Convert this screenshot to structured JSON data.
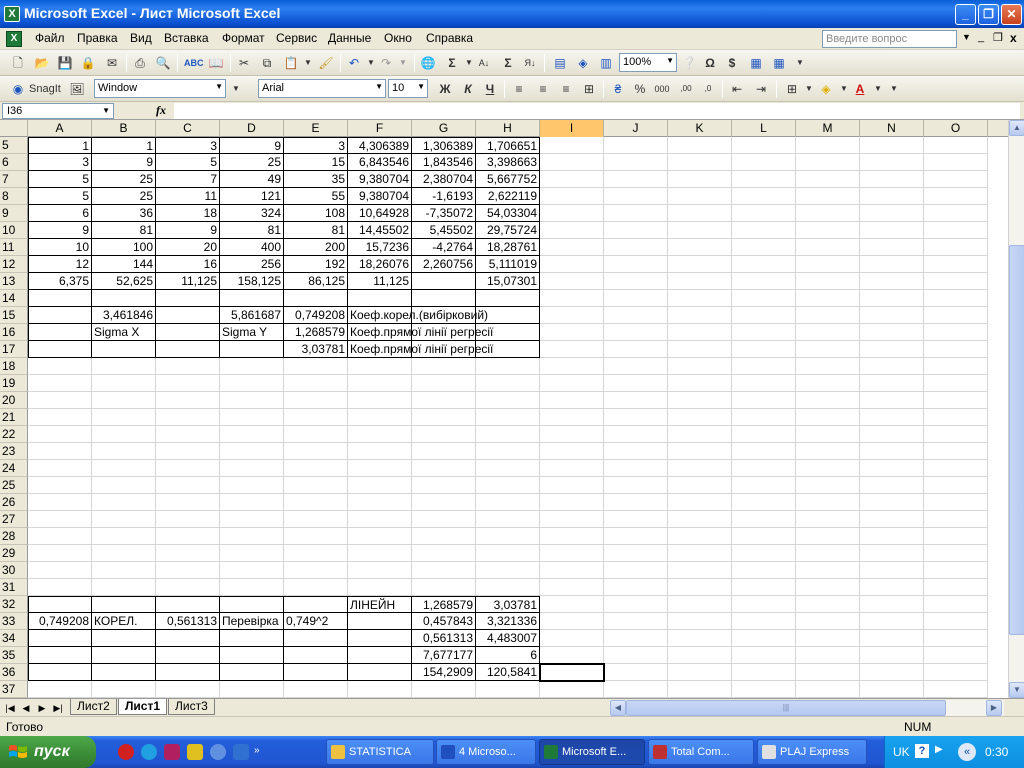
{
  "window": {
    "title": "Microsoft Excel - Лист Microsoft Excel",
    "app_icon": "excel-icon"
  },
  "menu": [
    "Файл",
    "Правка",
    "Вид",
    "Вставка",
    "Формат",
    "Сервис",
    "Данные",
    "Окно",
    "Справка"
  ],
  "ask_placeholder": "Введите вопрос",
  "toolbar1": {
    "zoom": "100%",
    "icons": [
      "new-icon",
      "open-icon",
      "save-icon",
      "permission-icon",
      "email-icon",
      "print-icon",
      "print-preview-icon",
      "spelling-icon",
      "research-icon",
      "cut-icon",
      "copy-icon",
      "paste-icon",
      "format-painter-icon",
      "undo-icon",
      "redo-icon",
      "hyperlink-icon",
      "autosum-icon",
      "sort-ascending-icon",
      "chart-wizard-icon",
      "drawing-icon",
      "help-icon"
    ]
  },
  "toolbar2": {
    "snagit_label": "SnagIt",
    "window_combo": "Window",
    "font": "Arial",
    "size": "10",
    "bold": "Ж",
    "italic": "К",
    "underline": "Ч",
    "percent": "%",
    "thousands": "000"
  },
  "formula_bar": {
    "name_box": "I36",
    "fx": "fx",
    "value": ""
  },
  "columns": [
    "A",
    "B",
    "C",
    "D",
    "E",
    "F",
    "G",
    "H",
    "I",
    "J",
    "K",
    "L",
    "M",
    "N",
    "O"
  ],
  "selected_column": "I",
  "rows": [
    {
      "n": "5",
      "cells": [
        "1",
        "1",
        "3",
        "9",
        "3",
        "4,306389",
        "1,306389",
        "1,706651",
        "",
        "",
        "",
        "",
        "",
        "",
        ""
      ]
    },
    {
      "n": "6",
      "cells": [
        "3",
        "9",
        "5",
        "25",
        "15",
        "6,843546",
        "1,843546",
        "3,398663",
        "",
        "",
        "",
        "",
        "",
        "",
        ""
      ]
    },
    {
      "n": "7",
      "cells": [
        "5",
        "25",
        "7",
        "49",
        "35",
        "9,380704",
        "2,380704",
        "5,667752",
        "",
        "",
        "",
        "",
        "",
        "",
        ""
      ]
    },
    {
      "n": "8",
      "cells": [
        "5",
        "25",
        "11",
        "121",
        "55",
        "9,380704",
        "-1,6193",
        "2,622119",
        "",
        "",
        "",
        "",
        "",
        "",
        ""
      ]
    },
    {
      "n": "9",
      "cells": [
        "6",
        "36",
        "18",
        "324",
        "108",
        "10,64928",
        "-7,35072",
        "54,03304",
        "",
        "",
        "",
        "",
        "",
        "",
        ""
      ]
    },
    {
      "n": "10",
      "cells": [
        "9",
        "81",
        "9",
        "81",
        "81",
        "14,45502",
        "5,45502",
        "29,75724",
        "",
        "",
        "",
        "",
        "",
        "",
        ""
      ]
    },
    {
      "n": "11",
      "cells": [
        "10",
        "100",
        "20",
        "400",
        "200",
        "15,7236",
        "-4,2764",
        "18,28761",
        "",
        "",
        "",
        "",
        "",
        "",
        ""
      ]
    },
    {
      "n": "12",
      "cells": [
        "12",
        "144",
        "16",
        "256",
        "192",
        "18,26076",
        "2,260756",
        "5,111019",
        "",
        "",
        "",
        "",
        "",
        "",
        ""
      ]
    },
    {
      "n": "13",
      "cells": [
        "6,375",
        "52,625",
        "11,125",
        "158,125",
        "86,125",
        "11,125",
        "",
        "15,07301",
        "",
        "",
        "",
        "",
        "",
        "",
        ""
      ]
    },
    {
      "n": "14",
      "cells": [
        "",
        "",
        "",
        "",
        "",
        "",
        "",
        "",
        "",
        "",
        "",
        "",
        "",
        "",
        ""
      ]
    },
    {
      "n": "15",
      "cells": [
        "",
        "3,461846",
        "",
        "5,861687",
        "0,749208",
        "Коеф.корел.(вибірковий)",
        "",
        "",
        "",
        "",
        "",
        "",
        "",
        "",
        ""
      ]
    },
    {
      "n": "16",
      "cells": [
        "",
        "Sigma X",
        "",
        "Sigma Y",
        "1,268579",
        "Коеф.прямої лінії регресії",
        "",
        "",
        "",
        "",
        "",
        "",
        "",
        "",
        ""
      ]
    },
    {
      "n": "17",
      "cells": [
        "",
        "",
        "",
        "",
        "3,03781",
        "Коеф.прямої лінії регресії",
        "",
        "",
        "",
        "",
        "",
        "",
        "",
        "",
        ""
      ]
    },
    {
      "n": "18",
      "cells": [
        "",
        "",
        "",
        "",
        "",
        "",
        "",
        "",
        "",
        "",
        "",
        "",
        "",
        "",
        ""
      ]
    },
    {
      "n": "19",
      "cells": [
        "",
        "",
        "",
        "",
        "",
        "",
        "",
        "",
        "",
        "",
        "",
        "",
        "",
        "",
        ""
      ]
    },
    {
      "n": "20",
      "cells": [
        "",
        "",
        "",
        "",
        "",
        "",
        "",
        "",
        "",
        "",
        "",
        "",
        "",
        "",
        ""
      ]
    },
    {
      "n": "21",
      "cells": [
        "",
        "",
        "",
        "",
        "",
        "",
        "",
        "",
        "",
        "",
        "",
        "",
        "",
        "",
        ""
      ]
    },
    {
      "n": "22",
      "cells": [
        "",
        "",
        "",
        "",
        "",
        "",
        "",
        "",
        "",
        "",
        "",
        "",
        "",
        "",
        ""
      ]
    },
    {
      "n": "23",
      "cells": [
        "",
        "",
        "",
        "",
        "",
        "",
        "",
        "",
        "",
        "",
        "",
        "",
        "",
        "",
        ""
      ]
    },
    {
      "n": "24",
      "cells": [
        "",
        "",
        "",
        "",
        "",
        "",
        "",
        "",
        "",
        "",
        "",
        "",
        "",
        "",
        ""
      ]
    },
    {
      "n": "25",
      "cells": [
        "",
        "",
        "",
        "",
        "",
        "",
        "",
        "",
        "",
        "",
        "",
        "",
        "",
        "",
        ""
      ]
    },
    {
      "n": "26",
      "cells": [
        "",
        "",
        "",
        "",
        "",
        "",
        "",
        "",
        "",
        "",
        "",
        "",
        "",
        "",
        ""
      ]
    },
    {
      "n": "27",
      "cells": [
        "",
        "",
        "",
        "",
        "",
        "",
        "",
        "",
        "",
        "",
        "",
        "",
        "",
        "",
        ""
      ]
    },
    {
      "n": "28",
      "cells": [
        "",
        "",
        "",
        "",
        "",
        "",
        "",
        "",
        "",
        "",
        "",
        "",
        "",
        "",
        ""
      ]
    },
    {
      "n": "29",
      "cells": [
        "",
        "",
        "",
        "",
        "",
        "",
        "",
        "",
        "",
        "",
        "",
        "",
        "",
        "",
        ""
      ]
    },
    {
      "n": "30",
      "cells": [
        "",
        "",
        "",
        "",
        "",
        "",
        "",
        "",
        "",
        "",
        "",
        "",
        "",
        "",
        ""
      ]
    },
    {
      "n": "31",
      "cells": [
        "",
        "",
        "",
        "",
        "",
        "",
        "",
        "",
        "",
        "",
        "",
        "",
        "",
        "",
        ""
      ]
    },
    {
      "n": "32",
      "cells": [
        "",
        "",
        "",
        "",
        "",
        "ЛІНЕЙН",
        "1,268579",
        "3,03781",
        "",
        "",
        "",
        "",
        "",
        "",
        ""
      ]
    },
    {
      "n": "33",
      "cells": [
        "0,749208",
        "КОРЕЛ.",
        "0,561313",
        "Перевірка",
        "0,749^2",
        "",
        "0,457843",
        "3,321336",
        "",
        "",
        "",
        "",
        "",
        "",
        ""
      ]
    },
    {
      "n": "34",
      "cells": [
        "",
        "",
        "",
        "",
        "",
        "",
        "0,561313",
        "4,483007",
        "",
        "",
        "",
        "",
        "",
        "",
        ""
      ]
    },
    {
      "n": "35",
      "cells": [
        "",
        "",
        "",
        "",
        "",
        "",
        "7,677177",
        "6",
        "",
        "",
        "",
        "",
        "",
        "",
        ""
      ]
    },
    {
      "n": "36",
      "cells": [
        "",
        "",
        "",
        "",
        "",
        "",
        "154,2909",
        "120,5841",
        "",
        "",
        "",
        "",
        "",
        "",
        ""
      ]
    },
    {
      "n": "37",
      "cells": [
        "",
        "",
        "",
        "",
        "",
        "",
        "",
        "",
        "",
        "",
        "",
        "",
        "",
        "",
        ""
      ]
    }
  ],
  "sheet_tabs": [
    {
      "label": "Лист2",
      "active": false
    },
    {
      "label": "Лист1",
      "active": true
    },
    {
      "label": "Лист3",
      "active": false
    }
  ],
  "status": {
    "left": "Готово",
    "num": "NUM"
  },
  "taskbar": {
    "start": "пуск",
    "tasks": [
      "STATISTICA",
      "4 Microso...",
      "Microsoft E...",
      "Total Com...",
      "PLAJ Express"
    ],
    "active_task": "Microsoft E...",
    "lang": "UK",
    "clock": "0:30"
  }
}
